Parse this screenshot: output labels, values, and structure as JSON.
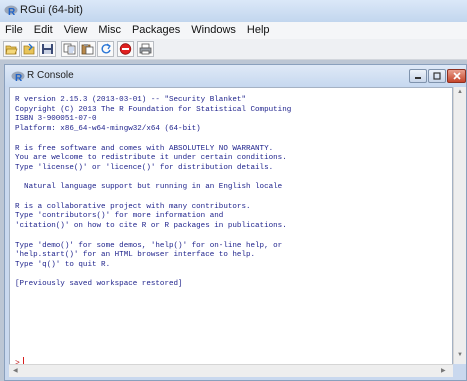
{
  "app": {
    "title": "RGui (64-bit)"
  },
  "menu": [
    "File",
    "Edit",
    "View",
    "Misc",
    "Packages",
    "Windows",
    "Help"
  ],
  "toolbar": {
    "buttons": [
      {
        "name": "open-script-icon"
      },
      {
        "name": "load-workspace-icon"
      },
      {
        "name": "save-workspace-icon"
      },
      {
        "name": "copy-icon"
      },
      {
        "name": "paste-icon"
      },
      {
        "name": "copy-paste-icon"
      },
      {
        "name": "stop-icon"
      },
      {
        "name": "print-icon"
      }
    ]
  },
  "console": {
    "title": "R Console",
    "text": "R version 2.15.3 (2013-03-01) -- \"Security Blanket\"\nCopyright (C) 2013 The R Foundation for Statistical Computing\nISBN 3-900051-07-0\nPlatform: x86_64-w64-mingw32/x64 (64-bit)\n\nR is free software and comes with ABSOLUTELY NO WARRANTY.\nYou are welcome to redistribute it under certain conditions.\nType 'license()' or 'licence()' for distribution details.\n\n  Natural language support but running in an English locale\n\nR is a collaborative project with many contributors.\nType 'contributors()' for more information and\n'citation()' on how to cite R or R packages in publications.\n\nType 'demo()' for some demos, 'help()' for on-line help, or\n'help.start()' for an HTML browser interface to help.\nType 'q()' to quit R.\n\n[Previously saved workspace restored]",
    "prompt": ">"
  },
  "colors": {
    "console_text": "#1b1f8a",
    "prompt": "#c01a1a",
    "stop_button": "#e02020"
  }
}
